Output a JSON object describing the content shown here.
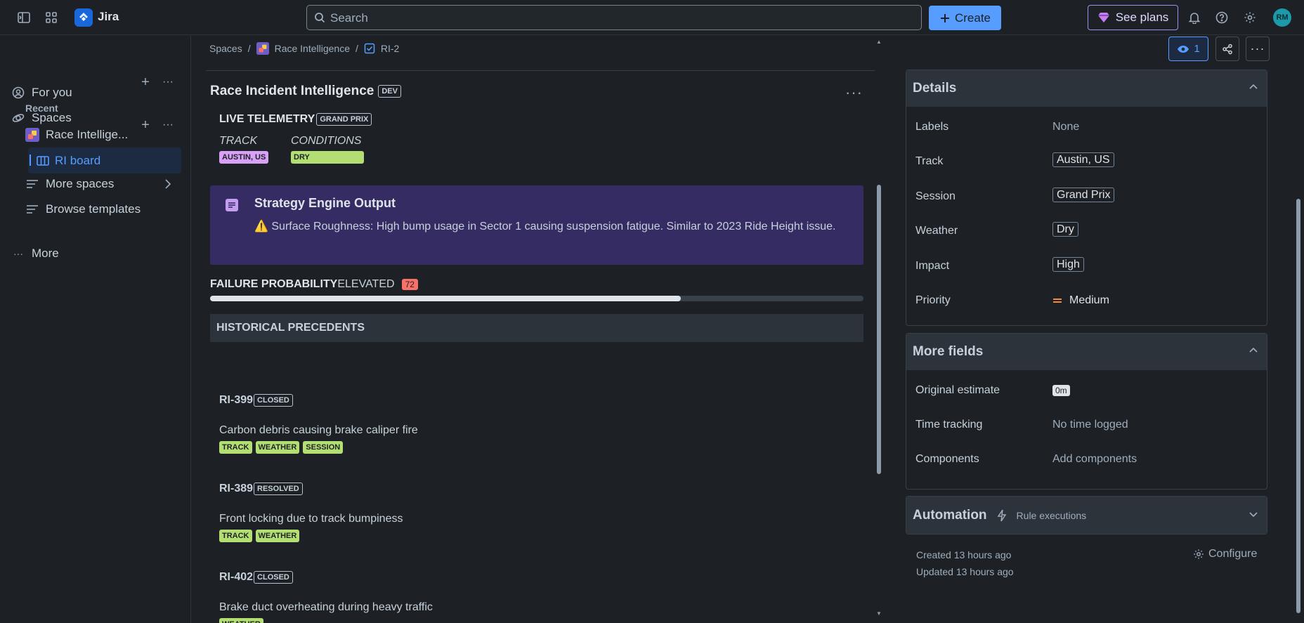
{
  "app": {
    "name": "Jira"
  },
  "search": {
    "placeholder": "Search"
  },
  "topbar": {
    "create_label": "Create",
    "plans_label": "See plans",
    "avatar_initials": "RM"
  },
  "sidebar": {
    "for_you": "For you",
    "spaces": "Spaces",
    "recent_label": "Recent",
    "recent_space": "Race Intellige...",
    "ri_board": "RI board",
    "more_spaces": "More spaces",
    "browse_templates": "Browse templates",
    "more": "More"
  },
  "breadcrumb": {
    "root": "Spaces",
    "space": "Race Intelligence",
    "issue": "RI-2"
  },
  "issue": {
    "title": "Race Incident Intelligence",
    "title_badge": "DEV",
    "telemetry_label": "LIVE TELEMETRY",
    "telemetry_badge": "GRAND PRIX",
    "track_label": "TRACK",
    "track_tag": "AUSTIN, US",
    "conditions_label": "CONDITIONS",
    "conditions_tag": "DRY",
    "strategy_title": "Strategy Engine Output",
    "strategy_text": "⚠️ Surface Roughness: High bump usage in Sector 1 causing suspension fatigue. Similar to 2023 Ride Height issue.",
    "failure_label": "FAILURE PROBABILITY",
    "failure_level": "ELEVATED",
    "failure_score": "72",
    "failure_fraction": 0.72,
    "historical_header": "HISTORICAL PRECEDENTS"
  },
  "precedents": [
    {
      "id": "RI-399",
      "status": "CLOSED",
      "desc": "Carbon debris causing brake caliper fire",
      "tags": [
        "TRACK",
        "WEATHER",
        "SESSION"
      ]
    },
    {
      "id": "RI-389",
      "status": "RESOLVED",
      "desc": "Front locking due to track bumpiness",
      "tags": [
        "TRACK",
        "WEATHER"
      ]
    },
    {
      "id": "RI-402",
      "status": "CLOSED",
      "desc": "Brake duct overheating during heavy traffic",
      "tags": [
        "WEATHER"
      ]
    }
  ],
  "right": {
    "watch_count": "1",
    "details_title": "Details",
    "fields": [
      {
        "name": "Labels",
        "value": "None"
      },
      {
        "name": "Track",
        "value": "Austin, US"
      },
      {
        "name": "Session",
        "value": "Grand Prix"
      },
      {
        "name": "Weather",
        "value": "Dry"
      },
      {
        "name": "Impact",
        "value": "High"
      },
      {
        "name": "Priority",
        "value": "Medium"
      }
    ],
    "more_fields_title": "More fields",
    "more_fields": [
      {
        "name": "Original estimate",
        "value": "0m"
      },
      {
        "name": "Time tracking",
        "value": "No time logged"
      },
      {
        "name": "Components",
        "value": "Add components"
      }
    ],
    "automation_title": "Automation",
    "automation_sub": "Rule executions",
    "created": "Created 13 hours ago",
    "updated": "Updated 13 hours ago",
    "configure": "Configure"
  },
  "colors": {
    "accent": "#579dff",
    "tag_green": "#b3df72",
    "tag_purple": "#d8a0f7",
    "strategy_bg": "#352c63",
    "score_red": "#f87168",
    "priority_orange": "#f38a3f"
  }
}
